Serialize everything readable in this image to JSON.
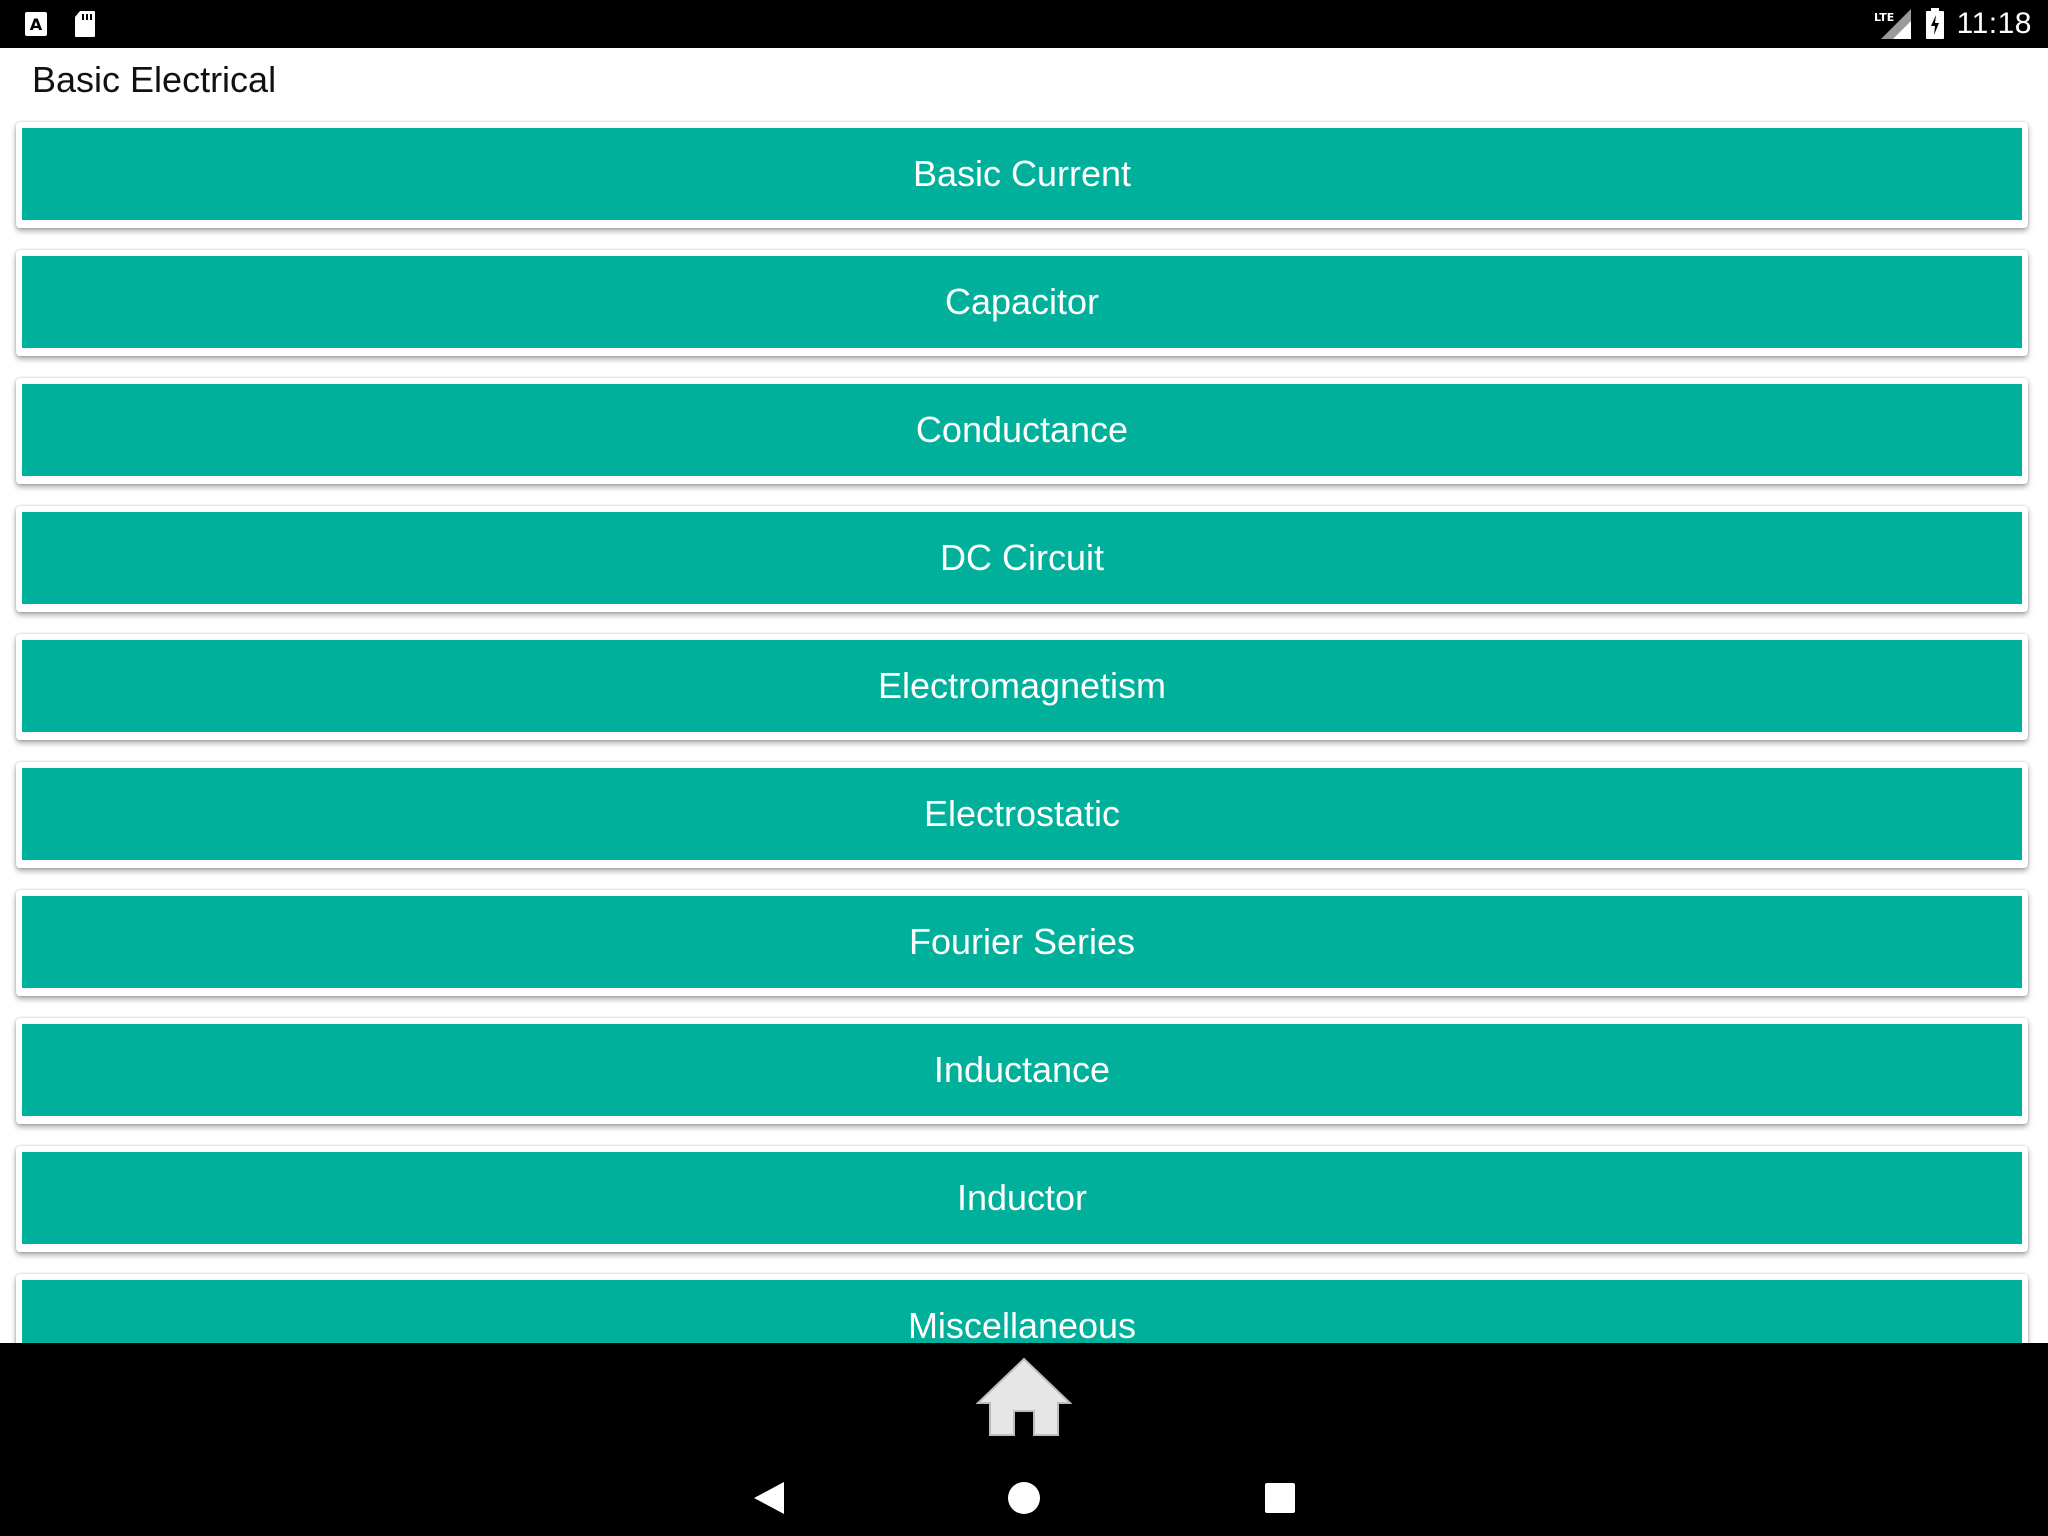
{
  "status_bar": {
    "time": "11:18",
    "network_label": "LTE",
    "left_icons": [
      "a-notification-icon",
      "sd-card-icon"
    ],
    "right_icons": [
      "lte-signal-icon",
      "battery-charging-icon"
    ]
  },
  "app": {
    "title": "Basic Electrical"
  },
  "topics": [
    "Basic Current",
    "Capacitor",
    "Conductance",
    "DC Circuit",
    "Electromagnetism",
    "Electrostatic",
    "Fourier Series",
    "Inductance",
    "Inductor",
    "Miscellaneous"
  ],
  "bottom_bar": {
    "home_icon": "home-icon"
  },
  "nav_bar": {
    "buttons": [
      "back-icon",
      "home-circle-icon",
      "recents-icon"
    ]
  },
  "colors": {
    "accent": "#00b09b",
    "status_bar": "#000000",
    "background": "#ffffff",
    "button_text": "#ffffff"
  }
}
